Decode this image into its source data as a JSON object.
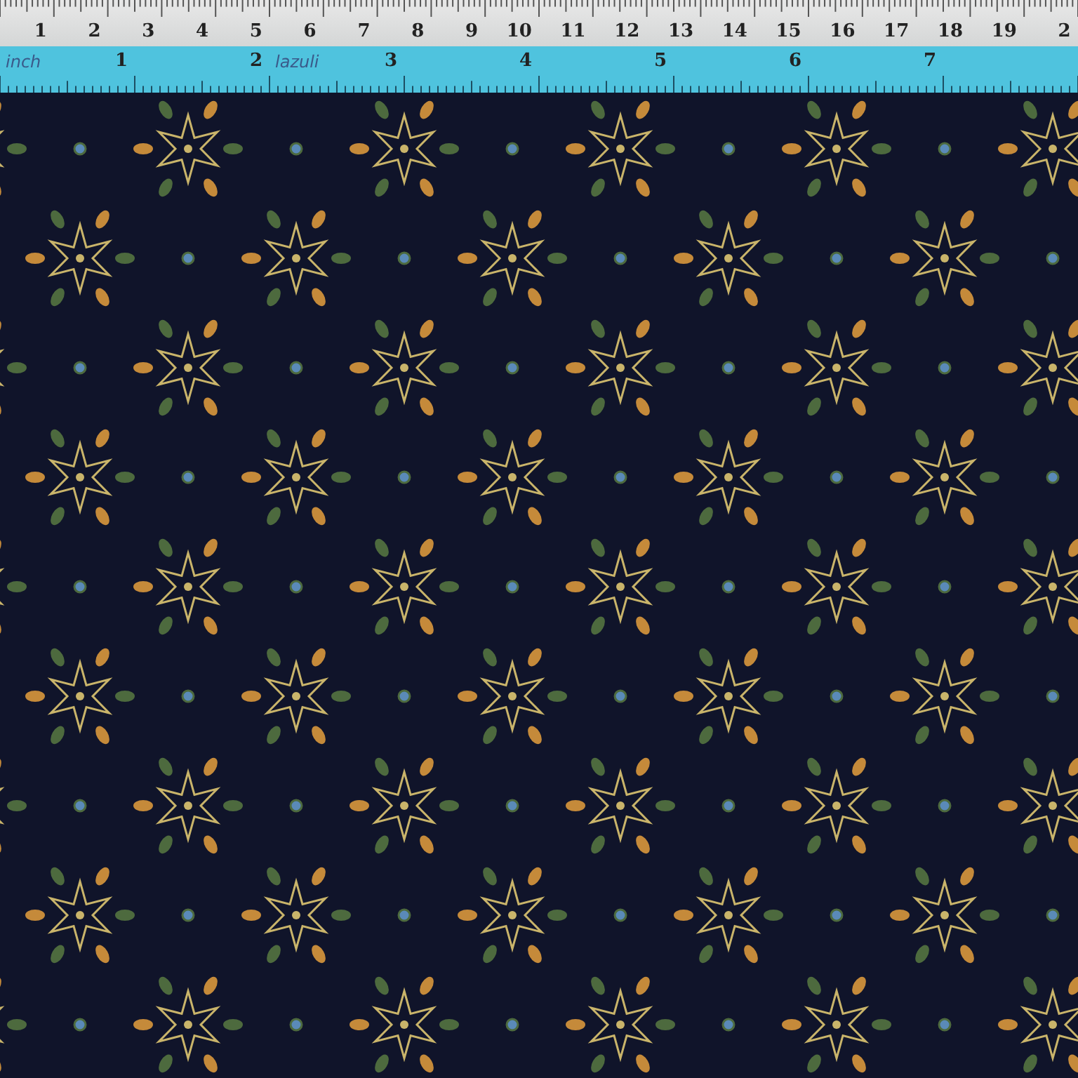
{
  "cm_ruler": {
    "labels": [
      "1",
      "2",
      "3",
      "4",
      "5",
      "6",
      "7",
      "8",
      "9",
      "10",
      "11",
      "12",
      "13",
      "14",
      "15",
      "16",
      "17",
      "18",
      "19",
      "2"
    ]
  },
  "inch_ruler": {
    "unit_label": "inch",
    "note": "lazuli",
    "labels": [
      "1",
      "2",
      "3",
      "4",
      "5",
      "6",
      "7"
    ]
  }
}
